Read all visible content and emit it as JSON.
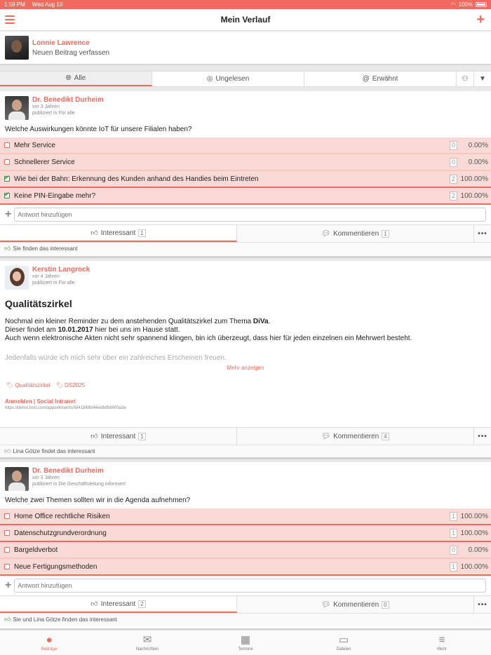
{
  "status_bar": {
    "time": "1:59 PM",
    "date": "Wed Aug 19",
    "battery": "100%"
  },
  "header": {
    "title": "Mein Verlauf"
  },
  "compose": {
    "name": "Lonnie Lawrence",
    "placeholder": "Neuen Beitrag verfassen"
  },
  "filter_tabs": [
    {
      "label": "Alle",
      "icon": "globe-icon",
      "active": true
    },
    {
      "label": "Ungelesen",
      "icon": "eye-slash-icon",
      "active": false
    },
    {
      "label": "Erwähnt",
      "icon": "at-icon",
      "active": false
    }
  ],
  "posts": [
    {
      "author": "Dr. Benedikt Durheim",
      "time": "vor 3 Jahren",
      "published": "publiziert in Für alle",
      "question": "Welche Auswirkungen könnte IoT für unsere Filialen haben?",
      "options": [
        {
          "label": "Mehr Service",
          "count": "0",
          "pct": "0.00%",
          "checked": false
        },
        {
          "label": "Schnellerer Service",
          "count": "0",
          "pct": "0.00%",
          "checked": false
        },
        {
          "label": "Wie bei der Bahn: Erkennung des Kunden anhand des Handies beim Eintreten",
          "count": "2",
          "pct": "100.00%",
          "checked": true
        },
        {
          "label": "Keine PIN-Eingabe mehr?",
          "count": "2",
          "pct": "100.00%",
          "checked": true
        }
      ],
      "answer_placeholder": "Antwort hinzufügen",
      "interesting_label": "Interessant",
      "interesting_count": "1",
      "comment_label": "Kommentieren",
      "comment_count": "1",
      "likes_text": "Sie finden das interessant"
    },
    {
      "author": "Kerstin Langrock",
      "time": "vor 4 Jahren",
      "published": "publiziert in Für alle",
      "title": "Qualitätszirkel",
      "body_line1_pre": "Nochmal ein kleiner Reminder zu dem anstehenden Qualitätszirkel zum Thema ",
      "body_line1_bold": "DiVa",
      "body_line1_post": ".",
      "body_line2_pre": "Dieser findet am ",
      "body_line2_bold": "10.01.2017",
      "body_line2_post": " hier bei uns im Hause statt.",
      "body_line3": "Auch wenn elektronische Akten nicht sehr spannend klingen, bin ich überzeugt, dass hier für jeden einzelnen ein Mehrwert besteht.",
      "body_faded": "Jedenfalls würde ich mich sehr über ein zahlreiches Erscheinen freuen.",
      "more": "Mehr anzeigen",
      "tags": [
        "Qualitätszirkel",
        "DS2025"
      ],
      "link_title": "Anmelden | Social Intranet",
      "link_url": "https://demo.tixxt.com/appointments/5841848bf44edfefb9000a3e",
      "interesting_label": "Interessant",
      "interesting_count": "1",
      "comment_label": "Kommentieren",
      "comment_count": "4",
      "likes_text": "Lina Götze findet das interessant"
    },
    {
      "author": "Dr. Benedikt Durheim",
      "time": "vor 3 Jahren",
      "published": "publiziert in Die Geschäftsleitung informiert",
      "question": "Welche zwei Themen sollten wir in die Agenda aufnehmen?",
      "options": [
        {
          "label": "Home Office rechtliche Risiken",
          "count": "1",
          "pct": "100.00%",
          "checked": false
        },
        {
          "label": "Datenschutzgrundverordnung",
          "count": "1",
          "pct": "100.00%",
          "checked": false
        },
        {
          "label": "Bargeldverbot",
          "count": "0",
          "pct": "0.00%",
          "checked": false
        },
        {
          "label": "Neue Fertigungsmethoden",
          "count": "1",
          "pct": "100.00%",
          "checked": false
        }
      ],
      "answer_placeholder": "Antwort hinzufügen",
      "interesting_label": "Interessant",
      "interesting_count": "2",
      "comment_label": "Kommentieren",
      "comment_count": "0",
      "likes_text": "Sie und Lina Götze finden das interessant"
    }
  ],
  "tabbar": [
    {
      "label": "Beiträge",
      "icon": "globe-icon",
      "active": true
    },
    {
      "label": "Nachrichten",
      "icon": "envelope-icon",
      "active": false
    },
    {
      "label": "Termine",
      "icon": "calendar-icon",
      "active": false
    },
    {
      "label": "Dateien",
      "icon": "folder-icon",
      "active": false
    },
    {
      "label": "Mehr",
      "icon": "menu-icon",
      "active": false
    }
  ],
  "colors": {
    "accent": "#ef6b5d",
    "option_bg": "#fadad6",
    "check_green": "#3a8a45"
  }
}
